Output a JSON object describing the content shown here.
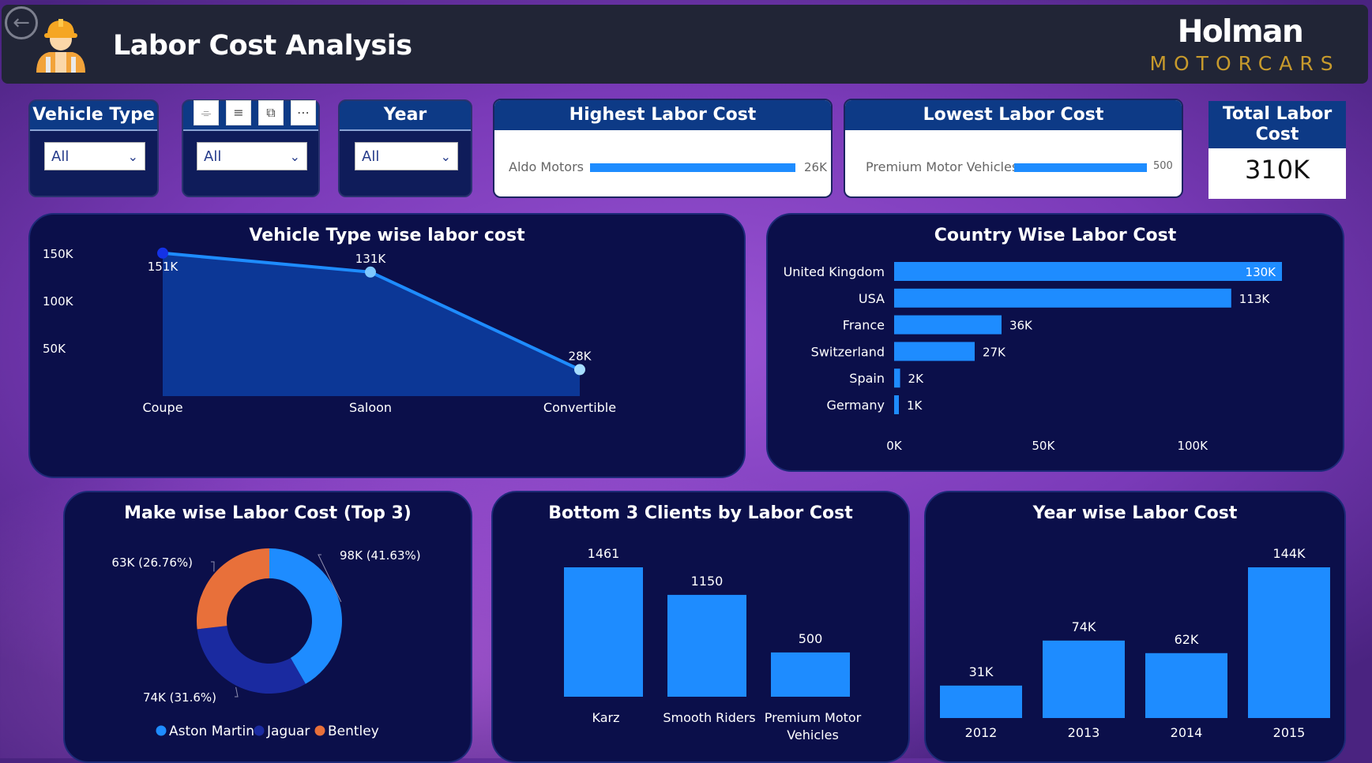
{
  "header": {
    "title": "Labor Cost Analysis",
    "brand_name": "Holman",
    "brand_sub": "MOTORCARS",
    "back_icon": "back-arrow-icon",
    "avatar_icon": "construction-worker-icon"
  },
  "slicers": [
    {
      "title": "Vehicle Type",
      "value": "All"
    },
    {
      "title": "",
      "value": "All"
    },
    {
      "title": "Year",
      "value": "All"
    }
  ],
  "visual_header_icons": [
    "bell-icon",
    "filter-icon",
    "focus-mode-icon",
    "more-options-icon"
  ],
  "kpis": {
    "highest": {
      "title": "Highest Labor Cost",
      "label": "Aldo Motors",
      "value": "26K",
      "fraction": 1.0
    },
    "lowest": {
      "title": "Lowest Labor Cost",
      "label": "Premium Motor Vehicles",
      "value": "500",
      "fraction": 1.0
    },
    "total": {
      "title": "Total Labor Cost",
      "value": "310K"
    }
  },
  "colors": {
    "accent": "#1e8cff",
    "panel": "#0b0f4a",
    "header": "#212536",
    "brand_gold": "#c79a2c",
    "aston_martin": "#1e8cff",
    "jaguar": "#1a2aa0",
    "bentley": "#e8703a"
  },
  "chart_data": [
    {
      "type": "area",
      "title": "Vehicle Type wise labor cost",
      "categories": [
        "Coupe",
        "Saloon",
        "Convertible"
      ],
      "values": [
        151,
        131,
        28
      ],
      "value_labels": [
        "151K",
        "131K",
        "28K"
      ],
      "yticks": [
        "50K",
        "100K",
        "150K"
      ],
      "ytick_values": [
        50,
        100,
        150
      ],
      "ylim": [
        0,
        160
      ],
      "unit": "K"
    },
    {
      "type": "bar",
      "orientation": "horizontal",
      "title": "Country Wise Labor Cost",
      "categories": [
        "United Kingdom",
        "USA",
        "France",
        "Switzerland",
        "Spain",
        "Germany"
      ],
      "values": [
        130,
        113,
        36,
        27,
        2,
        1
      ],
      "value_labels": [
        "130K",
        "113K",
        "36K",
        "27K",
        "2K",
        "1K"
      ],
      "xticks": [
        "0K",
        "50K",
        "100K"
      ],
      "xtick_values": [
        0,
        50,
        100
      ],
      "xlim": [
        0,
        130
      ]
    },
    {
      "type": "pie",
      "title": "Make wise Labor Cost (Top 3)",
      "categories": [
        "Aston Martin",
        "Jaguar",
        "Bentley"
      ],
      "values": [
        98,
        74,
        63
      ],
      "value_labels": [
        "98K (41.63%)",
        "74K (31.6%)",
        "63K (26.76%)"
      ],
      "legend": "bottom"
    },
    {
      "type": "bar",
      "title": "Bottom 3 Clients by Labor Cost",
      "categories": [
        "Karz",
        "Smooth Riders",
        "Premium Motor Vehicles"
      ],
      "category_lines": [
        [
          "Karz"
        ],
        [
          "Smooth Riders"
        ],
        [
          "Premium Motor",
          "Vehicles"
        ]
      ],
      "values": [
        1461,
        1150,
        500
      ],
      "value_labels": [
        "1461",
        "1150",
        "500"
      ],
      "ylim": [
        0,
        1461
      ]
    },
    {
      "type": "bar",
      "title": "Year wise Labor Cost",
      "categories": [
        "2012",
        "2013",
        "2014",
        "2015"
      ],
      "values": [
        31,
        74,
        62,
        144
      ],
      "value_labels": [
        "31K",
        "74K",
        "62K",
        "144K"
      ],
      "ylim": [
        0,
        144
      ]
    }
  ]
}
